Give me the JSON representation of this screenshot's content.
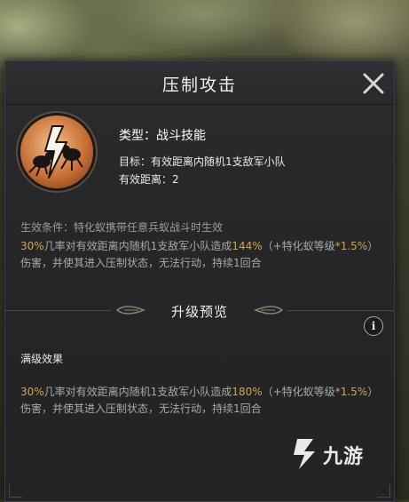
{
  "dialog": {
    "title": "压制攻击",
    "close_icon": "close-icon"
  },
  "skill": {
    "icon": "ant-strike-icon",
    "type_line": "类型：战斗技能",
    "target_line": "目标：有效距离内随机1支敌军小队",
    "range_line": "有效距离：2",
    "condition_line": "生效条件：特化蚁携带任意兵蚁战斗时生效",
    "effect": {
      "p1": "30%",
      "p2": "几率对有效距离内随机1支敌军小队造成",
      "p3": "144%",
      "p4": "（+特化蚁等级",
      "p5": "*1.5%",
      "p6": "）",
      "p7": "伤害，并使其进入压制状态，无法行动，持续1回合"
    }
  },
  "upgrade": {
    "title": "升级预览",
    "info_icon": "info-icon",
    "info_glyph": "i",
    "max_label": "满级效果",
    "effect": {
      "p1": "30%",
      "p2": "几率对有效距离内随机1支敌军小队造成",
      "p3": "180%",
      "p4": "（+特化蚁等级",
      "p5": "*1.5%",
      "p6": "）",
      "p7": "伤害，并使其进入压制状态，无法行动，持续1回合"
    }
  },
  "watermark": {
    "text": "九游",
    "icon": "jiuyou-logo-icon"
  },
  "colors": {
    "highlight": "#d4a24e",
    "body_text": "#a9a9a5",
    "panel_bg": "#242527"
  }
}
